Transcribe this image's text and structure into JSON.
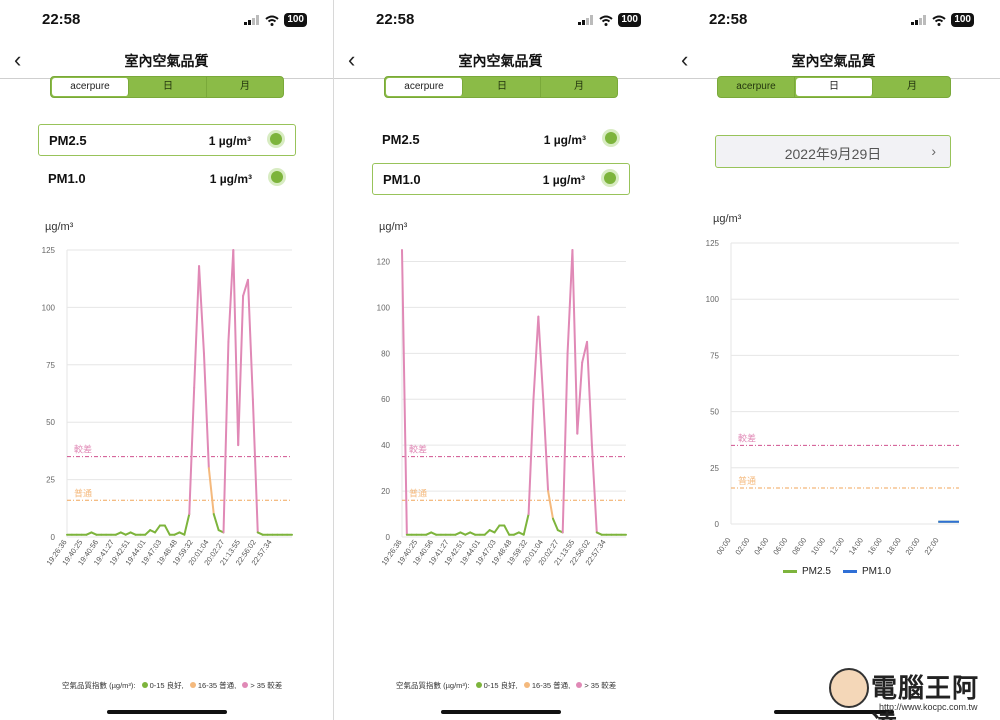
{
  "status": {
    "time": "22:58",
    "battery": "100"
  },
  "nav": {
    "title": "室內空氣品質"
  },
  "segments": [
    "acerpure",
    "日",
    "月"
  ],
  "pollutants": [
    {
      "name": "PM2.5",
      "value": "1 µg/m³"
    },
    {
      "name": "PM1.0",
      "value": "1 µg/m³"
    }
  ],
  "unit_label": "µg/m³",
  "thresholds": {
    "poor": "較差",
    "moderate": "普通"
  },
  "legend": {
    "title": "空氣品質指數 (µg/m³):",
    "good": "0-15 良好,",
    "moderate": "16-35 普通,",
    "poor": "> 35 較差"
  },
  "day_view": {
    "date": "2022年9月29日",
    "chevron": "›"
  },
  "colors": {
    "good": "#7db43c",
    "moderate": "#f4b97d",
    "poor": "#e089b6",
    "pm10": "#2f6fd6",
    "accent": "#8bbb47"
  },
  "watermark": {
    "brand": "電腦王阿達",
    "url": "http://www.kocpc.com.tw"
  },
  "chart_data": [
    {
      "type": "line",
      "title": "PM2.5",
      "ylabel": "µg/m³",
      "ylim": [
        0,
        125
      ],
      "yticks": [
        0,
        25,
        50,
        75,
        100,
        125
      ],
      "thresholds": [
        {
          "label": "較差",
          "value": 35
        },
        {
          "label": "普通",
          "value": 16
        }
      ],
      "x": [
        "19:26:36",
        "19:40:25",
        "19:40:56",
        "19:41:27",
        "19:42:51",
        "19:44:01",
        "19:47:03",
        "19:48:48",
        "19:59:32",
        "20:01:04",
        "20:02:27",
        "21:13:55",
        "22:56:02",
        "22:57:34"
      ],
      "series": [
        {
          "values": [
            1,
            1,
            1,
            1,
            1,
            2,
            1,
            1,
            1,
            1,
            1,
            2,
            1,
            2,
            1,
            1,
            1,
            3,
            2,
            5,
            5,
            1,
            1,
            2,
            1,
            10,
            65,
            118,
            80,
            30,
            10,
            3,
            2,
            85,
            125,
            40,
            105,
            112,
            60,
            2,
            1,
            1,
            1,
            1,
            1,
            1,
            1
          ]
        }
      ]
    },
    {
      "type": "line",
      "title": "PM1.0",
      "ylabel": "µg/m³",
      "ylim": [
        0,
        125
      ],
      "yticks": [
        0,
        20,
        40,
        60,
        80,
        100,
        120
      ],
      "thresholds": [
        {
          "label": "較差",
          "value": 35
        },
        {
          "label": "普通",
          "value": 16
        }
      ],
      "x": [
        "19:26:36",
        "19:40:25",
        "19:40:56",
        "19:41:27",
        "19:42:51",
        "19:44:01",
        "19:47:03",
        "19:48:48",
        "19:59:32",
        "20:01:04",
        "20:02:27",
        "21:13:55",
        "22:56:02",
        "22:57:34"
      ],
      "series": [
        {
          "values": [
            125,
            1,
            1,
            1,
            1,
            1,
            2,
            1,
            1,
            1,
            1,
            1,
            2,
            1,
            2,
            1,
            1,
            1,
            3,
            2,
            5,
            5,
            1,
            1,
            2,
            1,
            10,
            60,
            96,
            60,
            20,
            8,
            3,
            2,
            80,
            125,
            45,
            76,
            85,
            40,
            2,
            1,
            1,
            1,
            1,
            1,
            1
          ]
        }
      ]
    },
    {
      "type": "line",
      "ylabel": "µg/m³",
      "ylim": [
        0,
        125
      ],
      "yticks": [
        0,
        25,
        50,
        75,
        100,
        125
      ],
      "thresholds": [
        {
          "label": "較差",
          "value": 35
        },
        {
          "label": "普通",
          "value": 16
        }
      ],
      "x": [
        "00:00",
        "02:00",
        "04:00",
        "06:00",
        "08:00",
        "10:00",
        "12:00",
        "14:00",
        "16:00",
        "18:00",
        "20:00",
        "22:00"
      ],
      "series": [
        {
          "name": "PM2.5",
          "values": [
            null,
            null,
            null,
            null,
            null,
            null,
            null,
            null,
            null,
            null,
            1,
            1
          ]
        },
        {
          "name": "PM1.0",
          "values": [
            null,
            null,
            null,
            null,
            null,
            null,
            null,
            null,
            null,
            null,
            1,
            1
          ]
        }
      ]
    }
  ]
}
